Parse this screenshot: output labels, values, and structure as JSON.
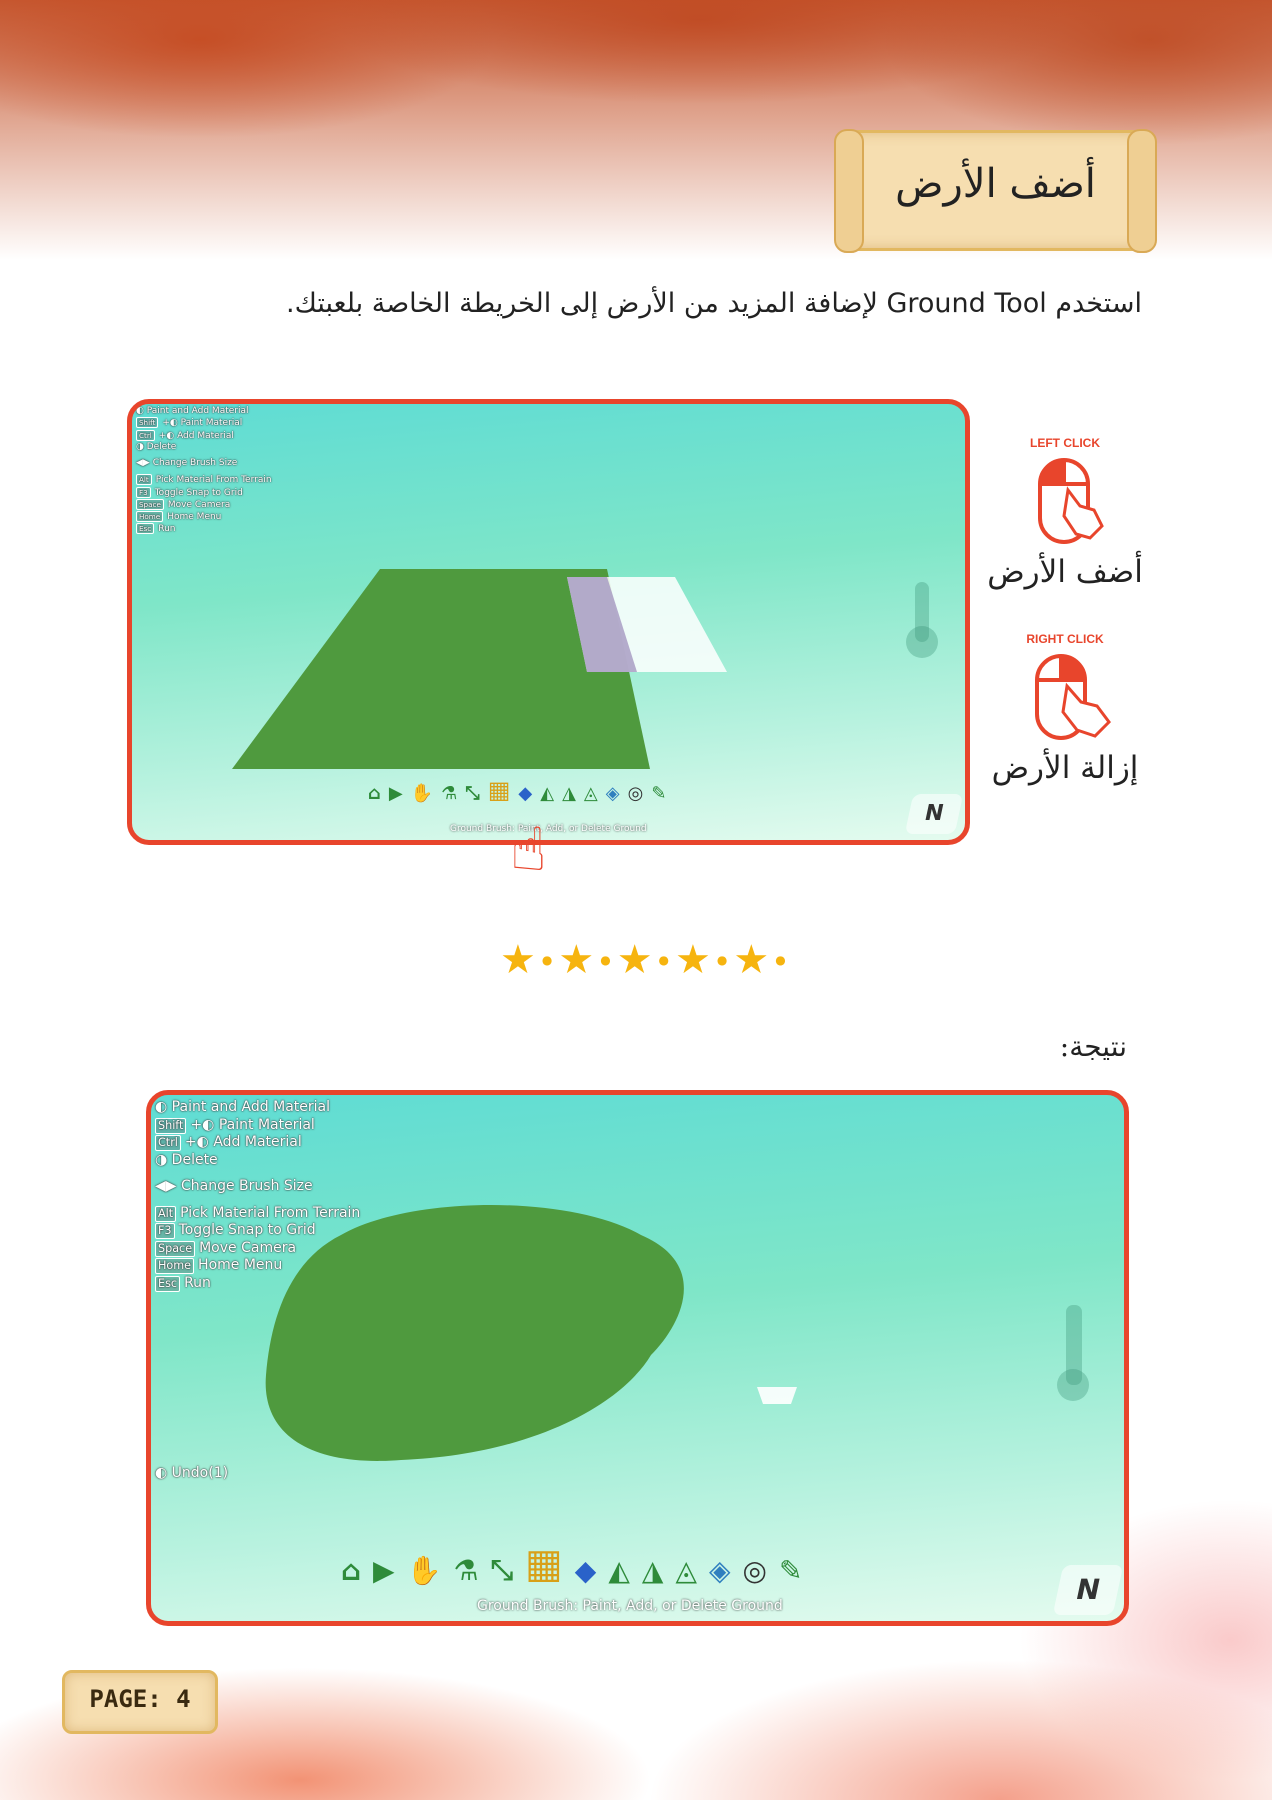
{
  "title": "أضف الأرض",
  "intro": "استخدم Ground Tool لإضافة المزيد من الأرض إلى الخريطة الخاصة بلعبتك.",
  "screenshot1": {
    "hints": [
      "Paint and Add Material",
      "Paint Material",
      "Add Material",
      "Delete",
      "Change Brush Size",
      "Pick Material From Terrain",
      "Toggle Snap to Grid",
      "Move Camera",
      "Home Menu",
      "Run"
    ],
    "keys": {
      "shift": "Shift",
      "ctrl": "Ctrl",
      "alt": "Alt",
      "f3": "F3",
      "space": "Space",
      "home": "Home",
      "esc": "Esc"
    },
    "toolbar_caption": "Ground Brush: Paint, Add, or Delete Ground"
  },
  "mouse": {
    "left_tag": "LEFT CLICK",
    "left_label": "أضف الأرض",
    "right_tag": "RIGHT CLICK",
    "right_label": "إزالة الأرض"
  },
  "result_label": "نتيجة:",
  "screenshot2": {
    "hints": [
      "Paint and Add Material",
      "Paint Material",
      "Add Material",
      "Delete",
      "Change Brush Size",
      "Pick Material From Terrain",
      "Toggle Snap to Grid",
      "Move Camera",
      "Home Menu",
      "Run"
    ],
    "keys": {
      "shift": "Shift",
      "ctrl": "Ctrl",
      "alt": "Alt",
      "f3": "F3",
      "space": "Space",
      "home": "Home",
      "esc": "Esc"
    },
    "undo": "Undo(1)",
    "toolbar_caption": "Ground Brush: Paint, Add, or Delete Ground"
  },
  "page_label": "PAGE: 4",
  "colors": {
    "accent": "#e8452c",
    "star": "#f6b40f",
    "grass": "#4f9a3e",
    "scroll": "#f6deb0"
  }
}
